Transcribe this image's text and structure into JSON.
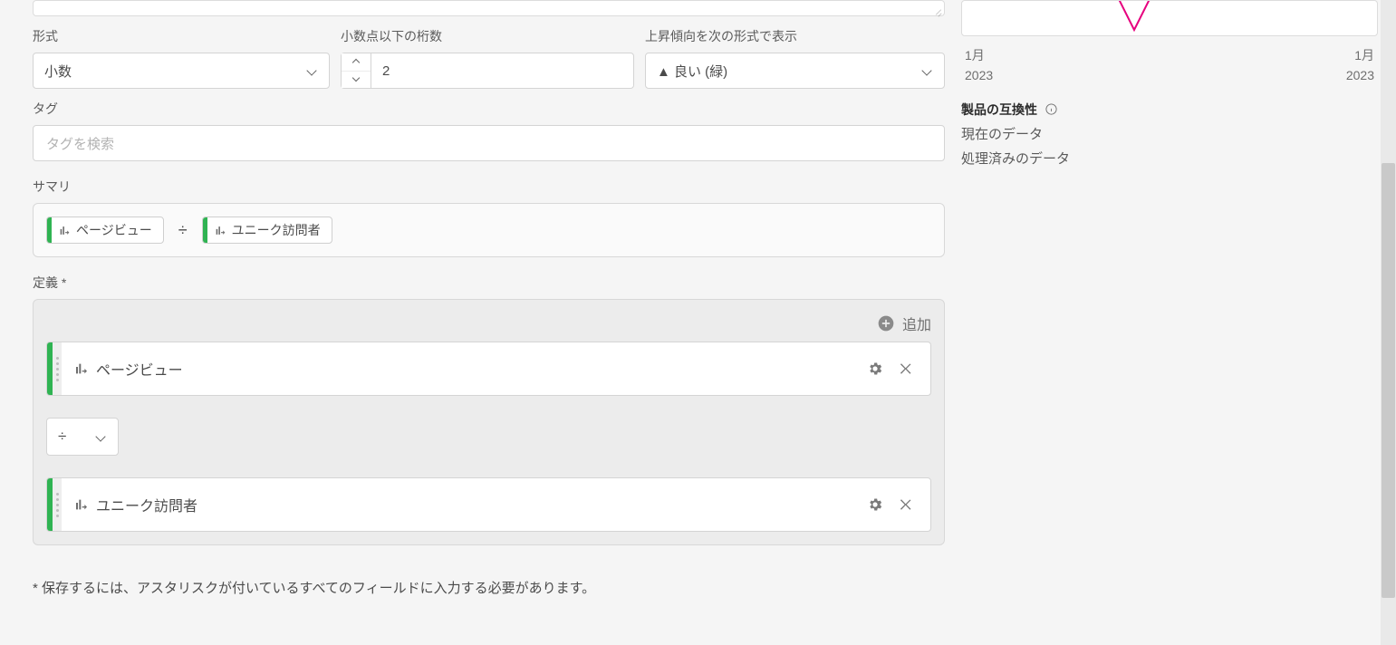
{
  "labels": {
    "format": "形式",
    "decimal_places": "小数点以下の桁数",
    "trend_display": "上昇傾向を次の形式で表示",
    "tags": "タグ",
    "summary": "サマリ",
    "definition": "定義 *",
    "add": "追加"
  },
  "fields": {
    "format_value": "小数",
    "decimal_value": "2",
    "trend_value": "▲ 良い (緑)",
    "tag_placeholder": "タグを検索"
  },
  "summary": {
    "chip1": "ページビュー",
    "operator": "÷",
    "chip2": "ユニーク訪問者"
  },
  "definition": {
    "row1": "ページビュー",
    "operator": "÷",
    "row2": "ユニーク訪問者"
  },
  "footnote": "* 保存するには、アスタリスクが付いているすべてのフィールドに入力する必要があります。",
  "preview": {
    "axis_left_month": "1月",
    "axis_left_year": "2023",
    "axis_right_month": "1月",
    "axis_right_year": "2023",
    "compat_title": "製品の互換性",
    "line1": "現在のデータ",
    "line2": "処理済みのデータ"
  }
}
